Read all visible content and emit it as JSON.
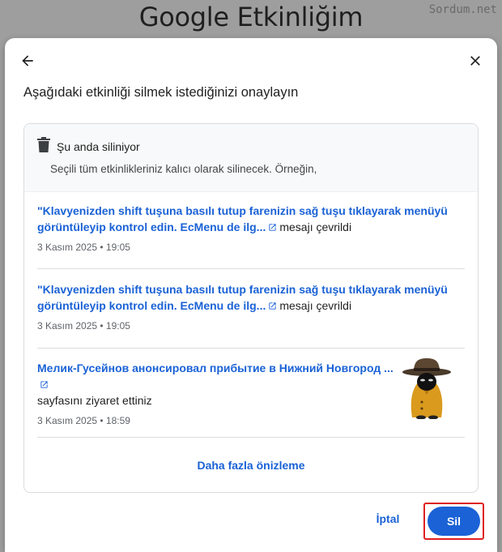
{
  "background": {
    "title": "Google Etkinliğim",
    "watermark": "Sordum.net"
  },
  "dialog": {
    "heading": "Aşağıdaki etkinliği silmek istediğinizi onaylayın",
    "icons": {
      "back": "arrow-back-icon",
      "close": "close-icon",
      "trash": "trash-icon",
      "external": "open-in-new-icon"
    },
    "card": {
      "title": "Şu anda siliniyor",
      "subtitle": "Seçili tüm etkinlikleriniz kalıcı olarak silinecek. Örneğin,",
      "items": [
        {
          "link_text": "\"Klavyenizden shift tuşuna basılı tutup farenizin sağ tuşu tıklayarak menüyü görüntüleyip kontrol edin. EcMenu de ilg...",
          "suffix": "mesajı çevrildi",
          "date": "3 Kasım 2025 • 19:05"
        },
        {
          "link_text": "\"Klavyenizden shift tuşuna basılı tutup farenizin sağ tuşu tıklayarak menüyü görüntüleyip kontrol edin. EcMenu de ilg...",
          "suffix": "mesajı çevrildi",
          "date": "3 Kasım 2025 • 19:05"
        },
        {
          "link_text": "Мелик-Гусейнов анонсировал прибытие в Нижний Новгород ...",
          "suffix": "sayfasını ziyaret ettiniz",
          "date": "3 Kasım 2025 • 18:59"
        }
      ],
      "more_label": "Daha fazla önizleme"
    },
    "cancel_label": "İptal",
    "delete_label": "Sil",
    "colors": {
      "accent": "#1a62d6",
      "highlight": "#e02020"
    }
  }
}
